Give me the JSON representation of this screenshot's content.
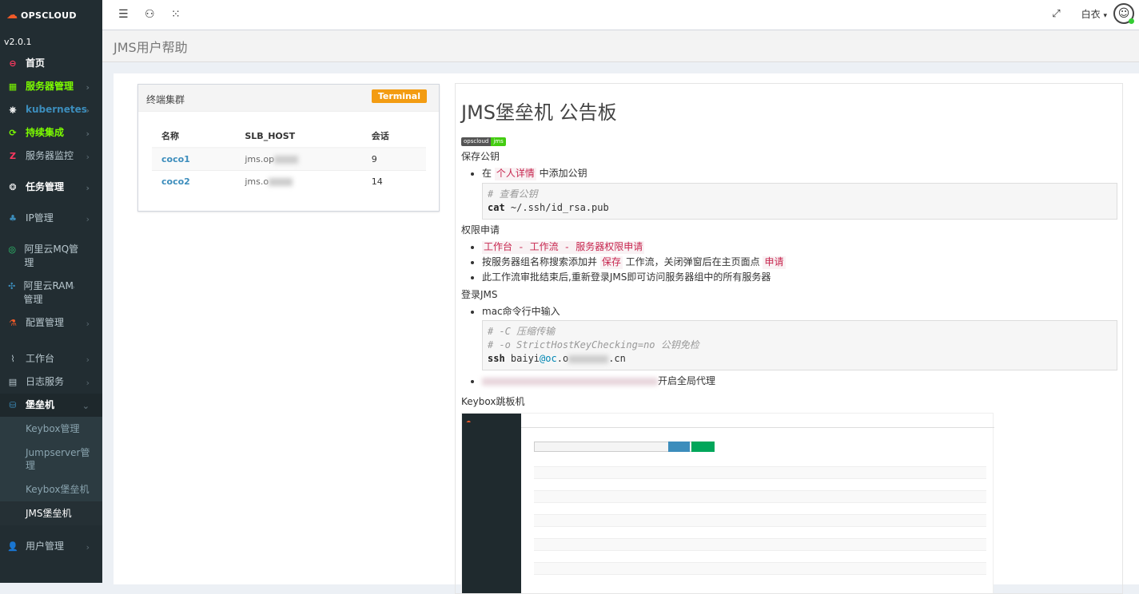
{
  "app": {
    "logo": "OPSCLOUD",
    "version": "v2.0.1"
  },
  "sidebar": {
    "items": [
      {
        "label": "首页",
        "icon": "dashboard-icon",
        "color": "#ff3860"
      },
      {
        "label": "服务器管理",
        "icon": "windows-icon",
        "color": "#7cfc00"
      },
      {
        "label": "kubernetes",
        "icon": "kubernetes-icon",
        "color": "#3c8dbc"
      },
      {
        "label": "持续集成",
        "icon": "refresh-icon",
        "color": "#7cfc00"
      },
      {
        "label": "服务器监控",
        "icon": "zabbix-icon",
        "color": "#ff3860"
      },
      {
        "label": "任务管理",
        "icon": "task-icon"
      },
      {
        "label": "IP管理",
        "icon": "network-icon"
      },
      {
        "label": "阿里云MQ管理",
        "icon": "mq-icon"
      },
      {
        "label": "阿里云RAM管理",
        "icon": "ram-icon"
      },
      {
        "label": "配置管理",
        "icon": "config-icon"
      },
      {
        "label": "工作台",
        "icon": "workbench-icon"
      },
      {
        "label": "日志服务",
        "icon": "log-icon"
      },
      {
        "label": "堡垒机",
        "icon": "bastion-icon"
      },
      {
        "label": "用户管理",
        "icon": "user-icon"
      }
    ],
    "bastion_sub": [
      "Keybox管理",
      "Jumpserver管理",
      "Keybox堡垒机",
      "JMS堡垒机"
    ]
  },
  "topbar": {
    "user": "白衣",
    "user_caret": "▾"
  },
  "page": {
    "title": "JMS用户帮助"
  },
  "cluster": {
    "title": "终端集群",
    "badge": "Terminal",
    "columns": [
      "名称",
      "SLB_HOST",
      "会话"
    ],
    "rows": [
      {
        "name": "coco1",
        "host": "jms.op",
        "sessions": "9"
      },
      {
        "name": "coco2",
        "host": "jms.o",
        "sessions": "14"
      }
    ]
  },
  "board": {
    "title": "JMS堡垒机 公告板",
    "badge_left": "opscloud",
    "badge_right": "jms",
    "s1": "保存公钥",
    "s1_li_a": "在 ",
    "s1_li_link": "个人详情",
    "s1_li_b": " 中添加公钥",
    "s1_code_c": "# 查看公钥",
    "s1_code_kw": "cat",
    "s1_code_rest": " ~/.ssh/id_rsa.pub",
    "s2": "权限申请",
    "s2_li1": "工作台 - 工作流 - 服务器权限申请",
    "s2_li2_a": "按服务器组名称搜索添加并 ",
    "s2_li2_save": "保存",
    "s2_li2_b": " 工作流，关闭弹窗后在主页面点 ",
    "s2_li2_apply": "申请",
    "s2_li3": "此工作流审批结束后,重新登录JMS即可访问服务器组中的所有服务器",
    "s3": "登录JMS",
    "s3_li": "mac命令行中输入",
    "s3_c1": "# -C 压缩传输",
    "s3_c2": "# -o StrictHostKeyChecking=no 公钥免检",
    "s3_kw": "ssh",
    "s3_user": " baiyi",
    "s3_at": "@oc",
    "s3_tail": ".o",
    "s3_end": ".cn",
    "s3_li2_tail": "开启全局代理",
    "s4": "Keybox跳板机"
  }
}
